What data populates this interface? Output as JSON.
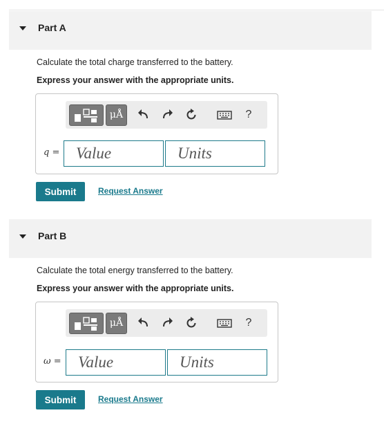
{
  "parts": [
    {
      "title": "Part A",
      "question": "Calculate the total charge transferred to the battery.",
      "instruction": "Express your answer with the appropriate units.",
      "variable_label": "q =",
      "value_placeholder": "Value",
      "units_placeholder": "Units",
      "submit_label": "Submit",
      "request_label": "Request Answer"
    },
    {
      "title": "Part B",
      "question": "Calculate the total energy transferred to the battery.",
      "instruction": "Express your answer with the appropriate units.",
      "variable_label": "ω =",
      "value_placeholder": "Value",
      "units_placeholder": "Units",
      "submit_label": "Submit",
      "request_label": "Request Answer"
    }
  ],
  "toolbar": {
    "units_button_label": "μÅ",
    "help_label": "?",
    "icons": [
      "templates-icon",
      "units-icon",
      "undo-icon",
      "redo-icon",
      "reset-icon",
      "keyboard-icon",
      "help-icon"
    ]
  },
  "colors": {
    "accent": "#1a7a8c",
    "header_bg": "#f2f2f2",
    "toolbar_bg": "#ececec",
    "toolbar_button": "#7a7a7a"
  }
}
